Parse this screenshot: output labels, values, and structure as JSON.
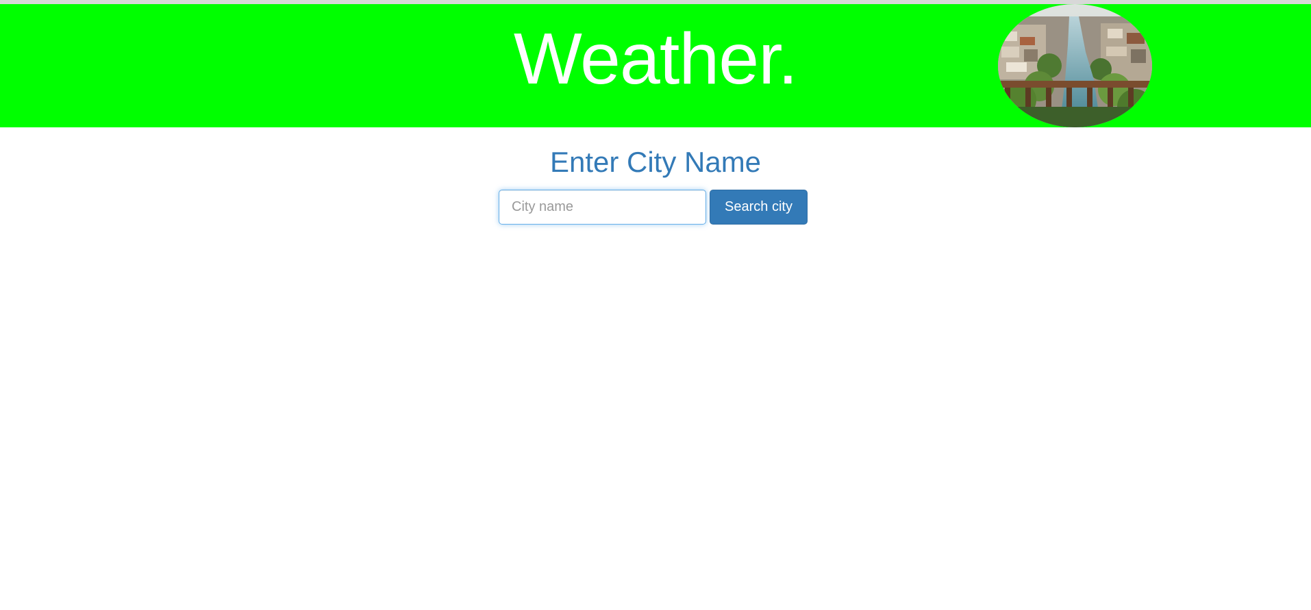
{
  "header": {
    "title": "Weather.",
    "background_color": "#00ff00",
    "image": "city-aerial-photo"
  },
  "main": {
    "heading": "Enter City Name",
    "search": {
      "value": "",
      "placeholder": "City name",
      "button_label": "Search city"
    }
  },
  "colors": {
    "heading": "#337ab7",
    "button": "#337ab7",
    "header_text": "#ffffff"
  }
}
